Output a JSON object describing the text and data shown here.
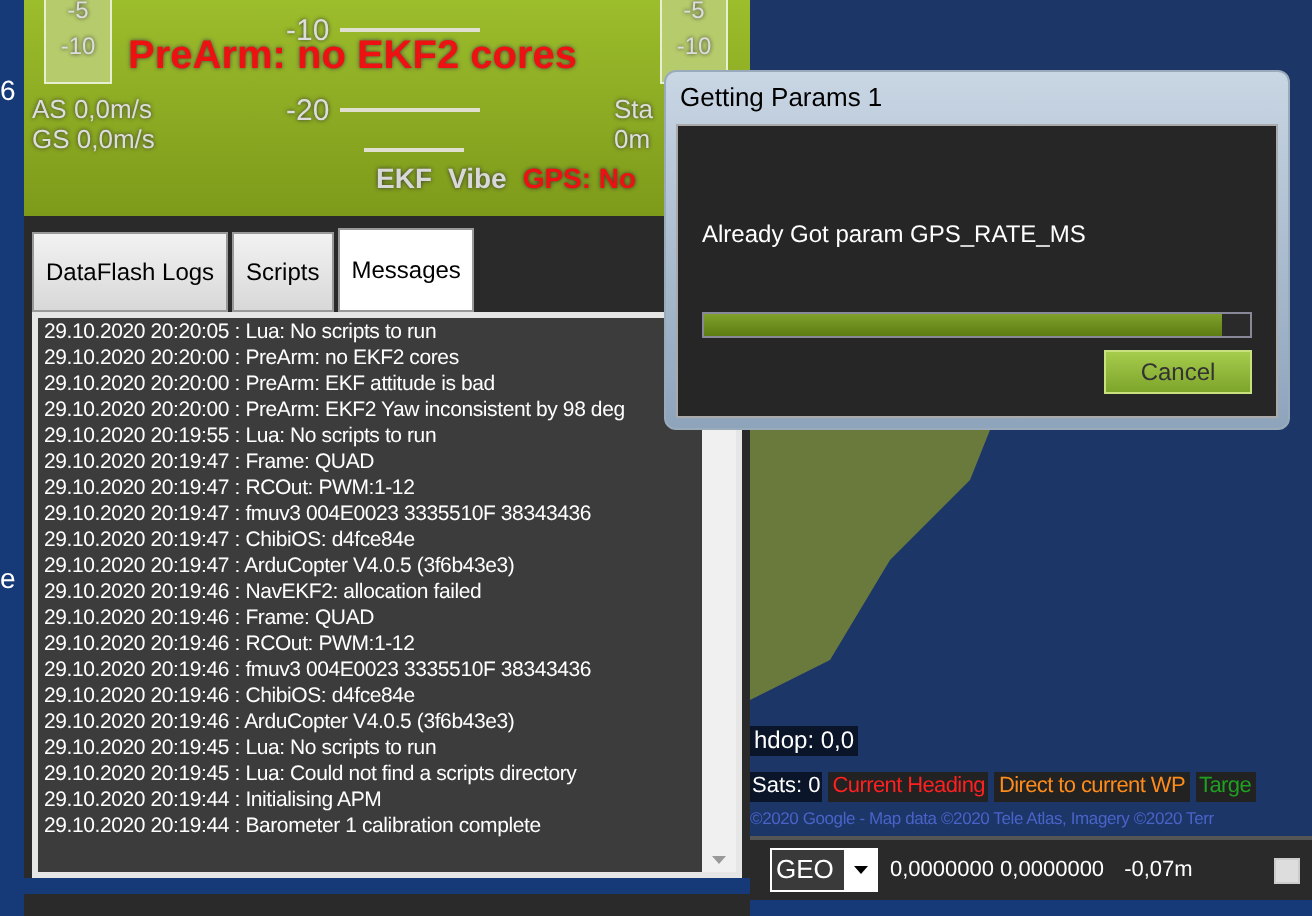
{
  "edge_marks": [
    "6",
    "e"
  ],
  "hud": {
    "left_tape": [
      "-5",
      "-10"
    ],
    "right_tape": [
      "-5",
      "-10"
    ],
    "pitch_labels": [
      "-10",
      "-20"
    ],
    "alert": "PreArm: no EKF2 cores",
    "airspeed": "AS 0,0m/s",
    "groundspeed": "GS 0,0m/s",
    "status_1": "Sta",
    "status_2": "0m",
    "indicators": [
      {
        "label": "EKF",
        "kind": "ok"
      },
      {
        "label": "Vibe",
        "kind": "ok"
      },
      {
        "label": "GPS: No",
        "kind": "warn"
      }
    ]
  },
  "tabs": [
    {
      "label": "DataFlash Logs",
      "selected": false
    },
    {
      "label": "Scripts",
      "selected": false
    },
    {
      "label": "Messages",
      "selected": true
    }
  ],
  "messages": [
    "29.10.2020 20:20:05 : Lua: No scripts to run",
    "29.10.2020 20:20:00 : PreArm: no EKF2 cores",
    "29.10.2020 20:20:00 : PreArm: EKF attitude is bad",
    "29.10.2020 20:20:00 : PreArm: EKF2 Yaw inconsistent by 98 deg",
    "29.10.2020 20:19:55 : Lua: No scripts to run",
    "29.10.2020 20:19:47 : Frame: QUAD",
    "29.10.2020 20:19:47 : RCOut: PWM:1-12",
    "29.10.2020 20:19:47 : fmuv3 004E0023 3335510F 38343436",
    "29.10.2020 20:19:47 : ChibiOS: d4fce84e",
    "29.10.2020 20:19:47 : ArduCopter V4.0.5 (3f6b43e3)",
    "29.10.2020 20:19:46 : NavEKF2: allocation failed",
    "29.10.2020 20:19:46 : Frame: QUAD",
    "29.10.2020 20:19:46 : RCOut: PWM:1-12",
    "29.10.2020 20:19:46 : fmuv3 004E0023 3335510F 38343436",
    "29.10.2020 20:19:46 : ChibiOS: d4fce84e",
    "29.10.2020 20:19:46 : ArduCopter V4.0.5 (3f6b43e3)",
    "29.10.2020 20:19:45 : Lua: No scripts to run",
    "29.10.2020 20:19:45 : Lua: Could not find a scripts directory",
    "29.10.2020 20:19:44 : Initialising APM",
    "29.10.2020 20:19:44 : Barometer 1 calibration complete"
  ],
  "map": {
    "hdop": "hdop: 0,0",
    "sats": "Sats: 0",
    "legend": [
      {
        "label": "Current Heading",
        "kind": "heading"
      },
      {
        "label": "Direct to current WP",
        "kind": "waypoint"
      },
      {
        "label": "Targe",
        "kind": "target"
      }
    ],
    "copyright": "©2020 Google - Map data ©2020 Tele Atlas, Imagery ©2020 Terr"
  },
  "coords_bar": {
    "format": "GEO",
    "coordinates": "0,0000000 0,0000000",
    "altitude": "-0,07m",
    "checked": false
  },
  "dialog": {
    "title": "Getting Params 1",
    "message": "Already Got param GPS_RATE_MS",
    "progress": {
      "level": 0.95
    },
    "buttons": [
      "Cancel"
    ]
  }
}
